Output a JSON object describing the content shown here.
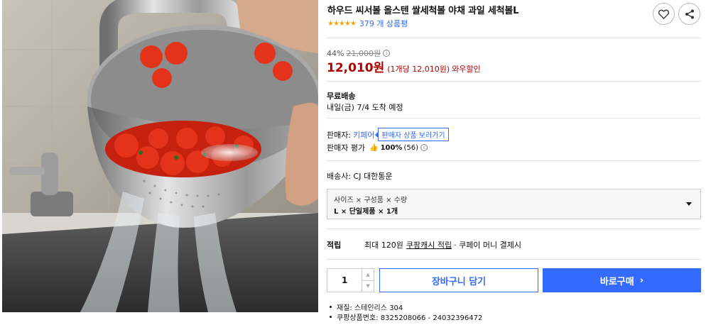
{
  "product": {
    "title": "하우드 씨서볼 올스텐 쌀세척볼 야채 과일 세척볼L",
    "stars": "★★★★★",
    "review_count": "379 개 상품평",
    "image_alt": "strainer-bowl-with-tomatoes-under-faucet"
  },
  "actions": {
    "wishlist_icon": "heart-icon",
    "share_icon": "share-icon"
  },
  "price": {
    "discount_rate": "44%",
    "original_price": "21,000원",
    "info_icon": "i",
    "sale_price": "12,010원",
    "unit_price": "(1개당 12,010원)",
    "wow_label": "와우할인"
  },
  "shipping": {
    "label": "무료배송",
    "arrival": "내일(금) 7/4 도착 예정"
  },
  "seller": {
    "label": "판매자:",
    "name": "키페어",
    "link": "판매자 상품 보러가기",
    "rating_label": "판매자 평가",
    "rating_percent": "100%",
    "rating_count": "(56)"
  },
  "courier": {
    "text": "배송사: CJ 대한통운"
  },
  "option": {
    "header": "사이즈 × 구성품 × 수량",
    "value": "L × 단일제품 × 1개"
  },
  "points": {
    "label": "적립",
    "text": "최대 120원",
    "link": "쿠팡캐시 적립",
    "tail": "· 쿠페이 머니 결제시"
  },
  "purchase": {
    "quantity": "1",
    "cart_label": "장바구니 담기",
    "buy_label": "바로구매",
    "buy_chevron": "›"
  },
  "specs": [
    "재질: 스테인리스 304",
    "쿠팡상품번호: 8325208066 - 24032396472"
  ],
  "colors": {
    "accent": "#346aff",
    "price_red": "#ae0000",
    "star": "#f3a60b"
  }
}
